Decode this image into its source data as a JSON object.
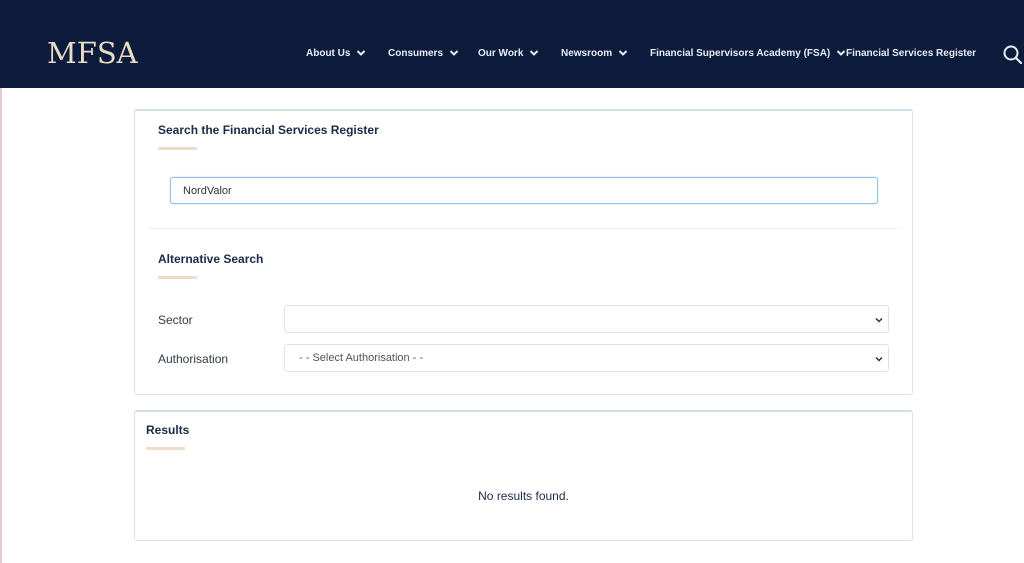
{
  "header": {
    "logo": "MFSA",
    "nav": [
      {
        "label": "About Us",
        "has_dropdown": true
      },
      {
        "label": "Consumers",
        "has_dropdown": true
      },
      {
        "label": "Our Work",
        "has_dropdown": true
      },
      {
        "label": "Newsroom",
        "has_dropdown": true
      },
      {
        "label": "Financial Supervisors Academy (FSA)",
        "has_dropdown": true
      },
      {
        "label": "Financial Services Register",
        "has_dropdown": false
      }
    ],
    "search_icon": "search-icon"
  },
  "search_section": {
    "title": "Search the Financial Services Register",
    "input_value": "NordValor"
  },
  "alternative_search": {
    "title": "Alternative Search",
    "sector_label": "Sector",
    "sector_value": "",
    "authorisation_label": "Authorisation",
    "authorisation_value": "- - Select Authorisation - -"
  },
  "results": {
    "title": "Results",
    "message": "No results found."
  },
  "colors": {
    "header_bg": "#0d1c3c",
    "logo": "#e8dcc4",
    "accent_underline": "#eddcc8",
    "input_focus_border": "#8fc3e0"
  }
}
